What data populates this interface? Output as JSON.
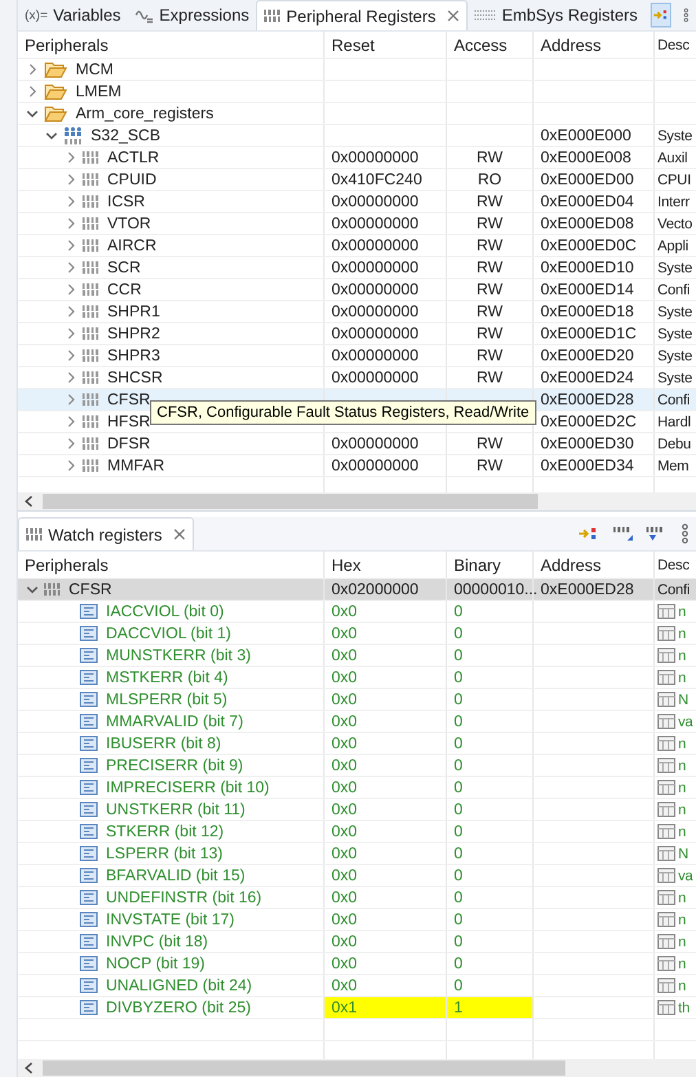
{
  "top_panel": {
    "tabs": [
      {
        "label": "Variables",
        "kind": "variables",
        "icon_text": "(x)=",
        "selected": false
      },
      {
        "label": "Expressions",
        "kind": "expressions",
        "selected": false
      },
      {
        "label": "Peripheral Registers",
        "kind": "binary",
        "selected": true
      },
      {
        "label": "EmbSys Registers",
        "kind": "embsys",
        "selected": false
      }
    ],
    "columns": [
      "Peripherals",
      "Reset",
      "Access",
      "Address",
      "Desc"
    ],
    "tree": [
      {
        "name": "MCM",
        "kind": "folder",
        "expanded": false,
        "selected": false
      },
      {
        "name": "LMEM",
        "kind": "folder",
        "expanded": false,
        "selected": false
      },
      {
        "name": "Arm_core_registers",
        "kind": "folder",
        "expanded": true,
        "selected": false,
        "children": [
          {
            "name": "S32_SCB",
            "kind": "peripheral",
            "expanded": true,
            "selected": false,
            "address": "0xE000E000",
            "description": "Syste",
            "children": [
              {
                "name": "ACTLR",
                "kind": "register",
                "expanded": false,
                "selected": false,
                "reset": "0x00000000",
                "access": "RW",
                "address": "0xE000E008",
                "description": "Auxil"
              },
              {
                "name": "CPUID",
                "kind": "register",
                "expanded": false,
                "selected": false,
                "reset": "0x410FC240",
                "access": "RO",
                "address": "0xE000ED00",
                "description": "CPUI"
              },
              {
                "name": "ICSR",
                "kind": "register",
                "expanded": false,
                "selected": false,
                "reset": "0x00000000",
                "access": "RW",
                "address": "0xE000ED04",
                "description": "Interr"
              },
              {
                "name": "VTOR",
                "kind": "register",
                "expanded": false,
                "selected": false,
                "reset": "0x00000000",
                "access": "RW",
                "address": "0xE000ED08",
                "description": "Vecto"
              },
              {
                "name": "AIRCR",
                "kind": "register",
                "expanded": false,
                "selected": false,
                "reset": "0x00000000",
                "access": "RW",
                "address": "0xE000ED0C",
                "description": "Appli"
              },
              {
                "name": "SCR",
                "kind": "register",
                "expanded": false,
                "selected": false,
                "reset": "0x00000000",
                "access": "RW",
                "address": "0xE000ED10",
                "description": "Syste"
              },
              {
                "name": "CCR",
                "kind": "register",
                "expanded": false,
                "selected": false,
                "reset": "0x00000000",
                "access": "RW",
                "address": "0xE000ED14",
                "description": "Confi"
              },
              {
                "name": "SHPR1",
                "kind": "register",
                "expanded": false,
                "selected": false,
                "reset": "0x00000000",
                "access": "RW",
                "address": "0xE000ED18",
                "description": "Syste"
              },
              {
                "name": "SHPR2",
                "kind": "register",
                "expanded": false,
                "selected": false,
                "reset": "0x00000000",
                "access": "RW",
                "address": "0xE000ED1C",
                "description": "Syste"
              },
              {
                "name": "SHPR3",
                "kind": "register",
                "expanded": false,
                "selected": false,
                "reset": "0x00000000",
                "access": "RW",
                "address": "0xE000ED20",
                "description": "Syste"
              },
              {
                "name": "SHCSR",
                "kind": "register",
                "expanded": false,
                "selected": false,
                "reset": "0x00000000",
                "access": "RW",
                "address": "0xE000ED24",
                "description": "Syste"
              },
              {
                "name": "CFSR",
                "kind": "register",
                "expanded": false,
                "selected": true,
                "address": "0xE000ED28",
                "description": "Confi"
              },
              {
                "name": "HFSR",
                "kind": "register",
                "expanded": false,
                "selected": false,
                "address": "0xE000ED2C",
                "description": "Hardl"
              },
              {
                "name": "DFSR",
                "kind": "register",
                "expanded": false,
                "selected": false,
                "reset": "0x00000000",
                "access": "RW",
                "address": "0xE000ED30",
                "description": "Debu"
              },
              {
                "name": "MMFAR",
                "kind": "register",
                "expanded": false,
                "selected": false,
                "reset": "0x00000000",
                "access": "RW",
                "address": "0xE000ED34",
                "description": "Mem"
              }
            ]
          }
        ]
      }
    ],
    "tooltip": "CFSR, Configurable Fault Status Registers, Read/Write"
  },
  "watch_panel": {
    "tab": {
      "label": "Watch registers",
      "selected": true
    },
    "columns": [
      "Peripherals",
      "Hex",
      "Binary",
      "Address",
      "Desc"
    ],
    "register": {
      "name": "CFSR",
      "expanded": true,
      "selected": true,
      "hex": "0x02000000",
      "binary": "00000010...",
      "address": "0xE000ED28",
      "description": "Confi",
      "fields": [
        {
          "name": "IACCVIOL (bit 0)",
          "hex": "0x0",
          "binary": "0",
          "description": "n",
          "changed": false
        },
        {
          "name": "DACCVIOL (bit 1)",
          "hex": "0x0",
          "binary": "0",
          "description": "n",
          "changed": false
        },
        {
          "name": "MUNSTKERR (bit 3)",
          "hex": "0x0",
          "binary": "0",
          "description": "n",
          "changed": false
        },
        {
          "name": "MSTKERR (bit 4)",
          "hex": "0x0",
          "binary": "0",
          "description": "n",
          "changed": false
        },
        {
          "name": "MLSPERR (bit 5)",
          "hex": "0x0",
          "binary": "0",
          "description": "N",
          "changed": false
        },
        {
          "name": "MMARVALID (bit 7)",
          "hex": "0x0",
          "binary": "0",
          "description": "va",
          "changed": false
        },
        {
          "name": "IBUSERR (bit 8)",
          "hex": "0x0",
          "binary": "0",
          "description": "n",
          "changed": false
        },
        {
          "name": "PRECISERR (bit 9)",
          "hex": "0x0",
          "binary": "0",
          "description": "n",
          "changed": false
        },
        {
          "name": "IMPRECISERR (bit 10)",
          "hex": "0x0",
          "binary": "0",
          "description": "n",
          "changed": false
        },
        {
          "name": "UNSTKERR (bit 11)",
          "hex": "0x0",
          "binary": "0",
          "description": "n",
          "changed": false
        },
        {
          "name": "STKERR (bit 12)",
          "hex": "0x0",
          "binary": "0",
          "description": "n",
          "changed": false
        },
        {
          "name": "LSPERR (bit 13)",
          "hex": "0x0",
          "binary": "0",
          "description": "N",
          "changed": false
        },
        {
          "name": "BFARVALID (bit 15)",
          "hex": "0x0",
          "binary": "0",
          "description": "va",
          "changed": false
        },
        {
          "name": "UNDEFINSTR (bit 16)",
          "hex": "0x0",
          "binary": "0",
          "description": "n",
          "changed": false
        },
        {
          "name": "INVSTATE (bit 17)",
          "hex": "0x0",
          "binary": "0",
          "description": "n",
          "changed": false
        },
        {
          "name": "INVPC (bit 18)",
          "hex": "0x0",
          "binary": "0",
          "description": "n",
          "changed": false
        },
        {
          "name": "NOCP (bit 19)",
          "hex": "0x0",
          "binary": "0",
          "description": "n",
          "changed": false
        },
        {
          "name": "UNALIGNED (bit 24)",
          "hex": "0x0",
          "binary": "0",
          "description": "n",
          "changed": false
        },
        {
          "name": "DIVBYZERO (bit 25)",
          "hex": "0x1",
          "binary": "1",
          "description": "th",
          "changed": true
        }
      ]
    }
  }
}
